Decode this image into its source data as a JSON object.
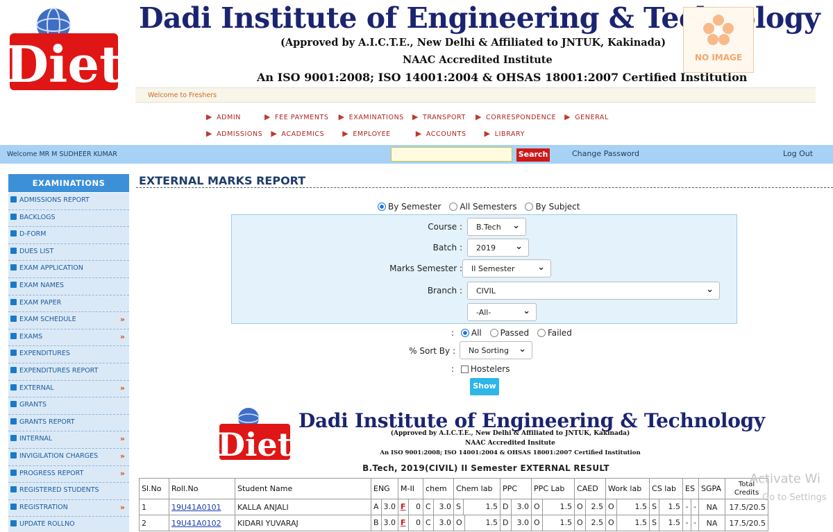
{
  "header": {
    "logo_text": "Diet",
    "title": "Dadi Institute of Engineering & Technology",
    "sub1": "(Approved by A.I.C.T.E., New Delhi & Affiliated to JNTUK, Kakinada)",
    "sub2": "NAAC Accredited Institute",
    "sub3": "An ISO 9001:2008; ISO 14001:2004 & OHSAS 18001:2007 Certified Institution",
    "no_image": "NO IMAGE"
  },
  "ticker": "Welcome to Freshers",
  "nav": {
    "row1": [
      "ADMIN",
      "FEE PAYMENTS",
      "EXAMINATIONS",
      "TRANSPORT",
      "CORRESPONDENCE",
      "GENERAL"
    ],
    "row2": [
      "ADMISSIONS",
      "ACADEMICS",
      "EMPLOYEE",
      "ACCOUNTS",
      "LIBRARY"
    ]
  },
  "topbar": {
    "welcome": "Welcome MR M SUDHEER KUMAR",
    "search_label": "Search",
    "change_password": "Change Password",
    "logout": "Log Out"
  },
  "sidebar": {
    "heading": "EXAMINATIONS",
    "items": [
      {
        "label": "ADMISSIONS REPORT",
        "more": false
      },
      {
        "label": "BACKLOGS",
        "more": false
      },
      {
        "label": "D-FORM",
        "more": false
      },
      {
        "label": "DUES LIST",
        "more": false
      },
      {
        "label": "EXAM APPLICATION",
        "more": false
      },
      {
        "label": "EXAM NAMES",
        "more": false
      },
      {
        "label": "EXAM PAPER",
        "more": false
      },
      {
        "label": "EXAM SCHEDULE",
        "more": true
      },
      {
        "label": "EXAMS",
        "more": true
      },
      {
        "label": "EXPENDITURES",
        "more": false
      },
      {
        "label": "EXPENDITURES REPORT",
        "more": false
      },
      {
        "label": "EXTERNAL",
        "more": true
      },
      {
        "label": "GRANTS",
        "more": false
      },
      {
        "label": "GRANTS REPORT",
        "more": false
      },
      {
        "label": "INTERNAL",
        "more": true
      },
      {
        "label": "INVIGILATION CHARGES",
        "more": true
      },
      {
        "label": "PROGRESS REPORT",
        "more": true
      },
      {
        "label": "REGISTERED STUDENTS",
        "more": false
      },
      {
        "label": "REGISTRATION",
        "more": true
      },
      {
        "label": "UPDATE ROLLNO",
        "more": false
      }
    ]
  },
  "main": {
    "title": "EXTERNAL MARKS REPORT",
    "mode": {
      "options": [
        "By Semester",
        "All Semesters",
        "By Subject"
      ],
      "selected": "By Semester"
    },
    "filters": {
      "course_label": "Course :",
      "course": "B.Tech",
      "batch_label": "Batch :",
      "batch": "2019",
      "sem_label": "Marks Semester :",
      "sem": "II Semester",
      "branch_label": "Branch :",
      "branch": "CIVIL",
      "section": "-All-"
    },
    "result_filter": {
      "prefix": ":",
      "options": [
        "All",
        "Passed",
        "Failed"
      ],
      "selected": "All"
    },
    "sort": {
      "label": "% Sort By :",
      "value": "No Sorting"
    },
    "hostelers": {
      "prefix": ":",
      "label": "Hostelers"
    },
    "show_label": "Show"
  },
  "report": {
    "logo_text": "Diet",
    "title": "Dadi Institute of Engineering & Technology",
    "sub1": "(Approved by A.I.C.T.E., New Delhi & Affiliated to JNTUK, Kakinada)",
    "sub2": "NAAC Accredited Insitute",
    "sub3": "An ISO 9001:2008; ISO 14001:2004 & OHSAS 18001:2007 Certified Institution",
    "result_title": "B.Tech, 2019(CIVIL) II Semester EXTERNAL RESULT"
  },
  "table": {
    "headers": [
      "Sl.No",
      "Roll.No",
      "Student Name",
      "ENG",
      "M-II",
      "chem",
      "Chem lab",
      "PPC",
      "PPC Lab",
      "CAED",
      "Work lab",
      "CS lab",
      "ES",
      "SGPA",
      "Total Credits"
    ],
    "rows": [
      {
        "sl": "1",
        "roll": "19U41A0101",
        "name": "KALLA ANJALI",
        "cells": [
          "A",
          "3.0",
          "F",
          "0",
          "C",
          "3.0",
          "S",
          "1.5",
          "D",
          "3.0",
          "O",
          "1.5",
          "O",
          "2.5",
          "O",
          "1.5",
          "S",
          "1.5",
          "-",
          "-"
        ],
        "sgpa": "NA",
        "total": "17.5/20.5"
      },
      {
        "sl": "2",
        "roll": "19U41A0102",
        "name": "KIDARI YUVARAJ",
        "cells": [
          "B",
          "3.0",
          "F",
          "0",
          "C",
          "3.0",
          "O",
          "1.5",
          "D",
          "3.0",
          "O",
          "1.5",
          "O",
          "2.5",
          "O",
          "1.5",
          "S",
          "1.5",
          "-",
          "-"
        ],
        "sgpa": "NA",
        "total": "17.5/20.5"
      }
    ]
  },
  "watermark": {
    "line1": "Activate Wi",
    "line2": "Go to Settings"
  },
  "colors": {
    "navy": "#1b2470",
    "bar": "#a8d2f5",
    "side_head": "#3c90d8",
    "side_item": "#dbe9f7",
    "search": "#d01818",
    "show": "#2fb6e8"
  }
}
